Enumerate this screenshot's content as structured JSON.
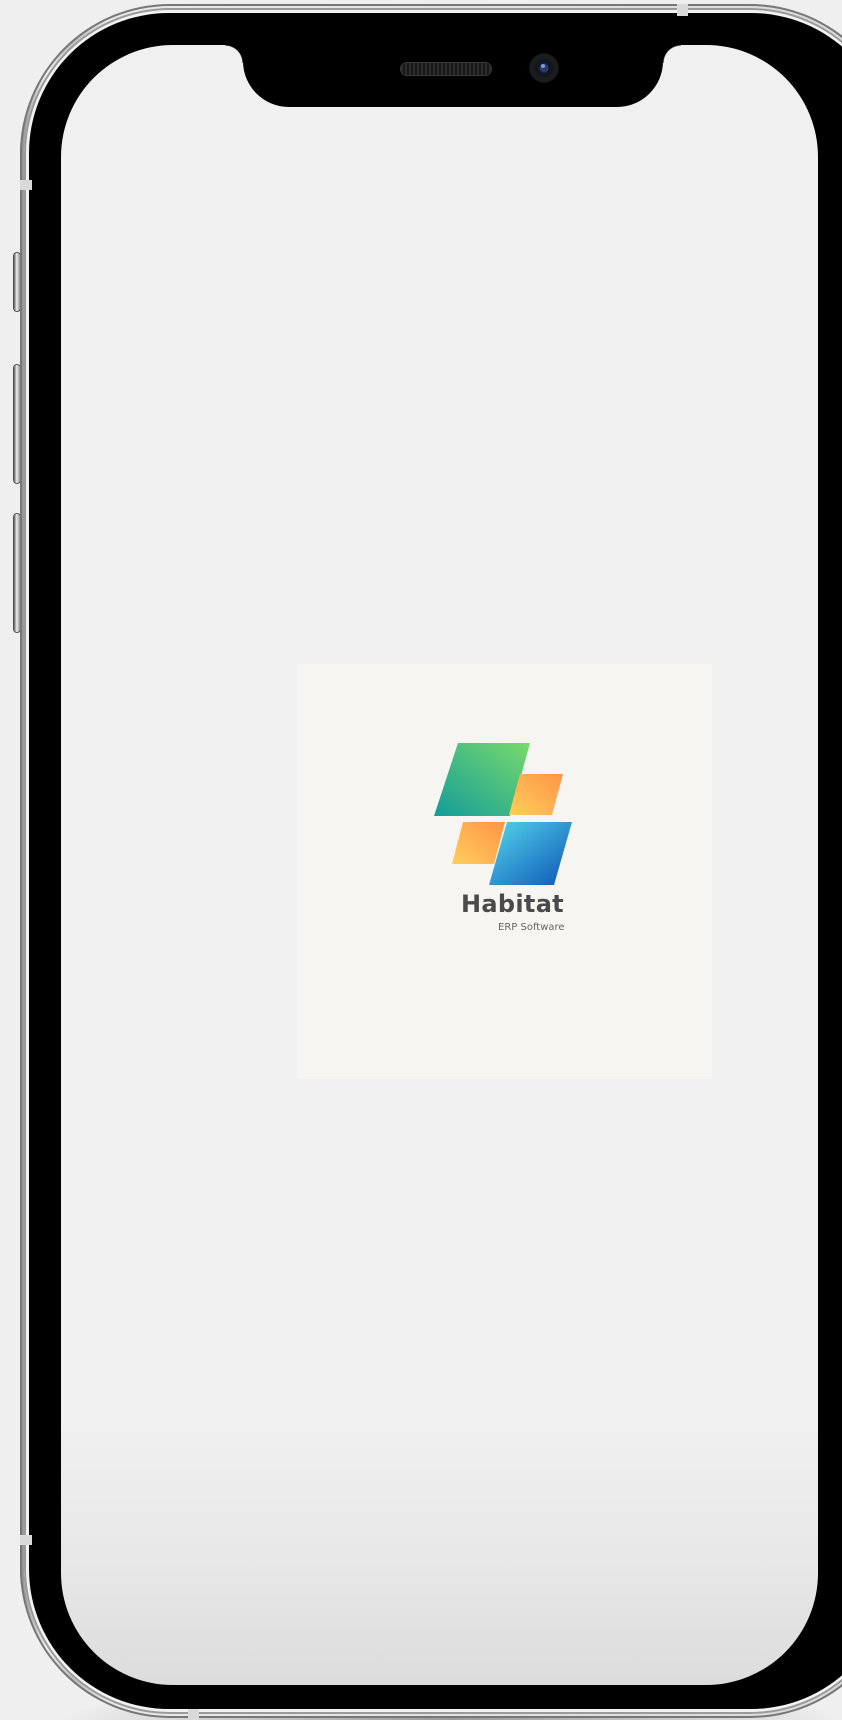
{
  "app": {
    "name": "Habitat",
    "tagline": "ERP Software"
  },
  "icons": {
    "logo": "habitat-logo-icon",
    "camera": "front-camera-icon",
    "speaker": "speaker-grille-icon"
  },
  "colors": {
    "background": "#efefef",
    "splash": "#f6f5f1",
    "text": "#4a4a4a",
    "tile_green_start": "#139c9a",
    "tile_green_end": "#79d96a",
    "tile_orange_start": "#ffce5c",
    "tile_orange_end": "#ff9446",
    "tile_blue_start": "#55d6ea",
    "tile_blue_end": "#0d55b8"
  }
}
